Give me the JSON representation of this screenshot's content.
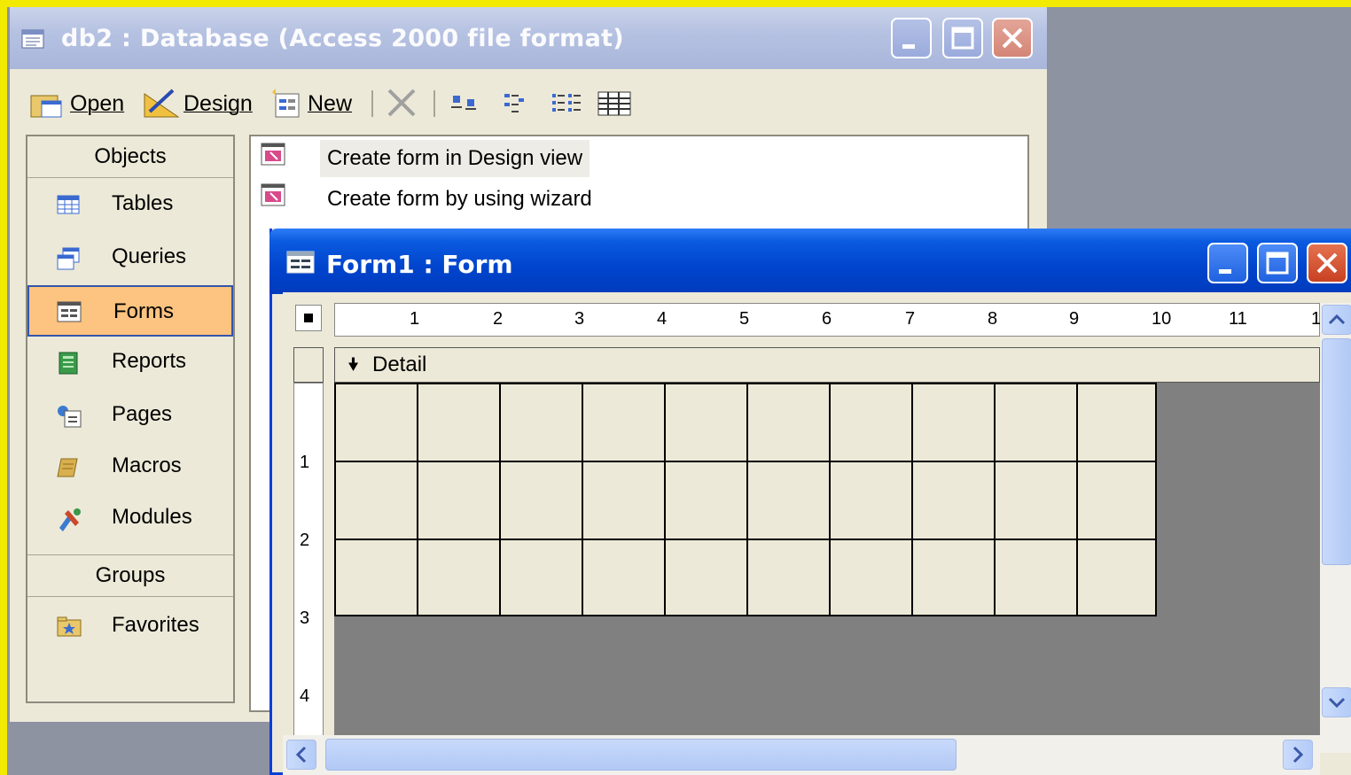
{
  "db_window": {
    "title": "db2 : Database (Access 2000 file format)",
    "toolbar": {
      "open": "Open",
      "design": "Design",
      "new": "New"
    },
    "objects_header": "Objects",
    "objects": [
      "Tables",
      "Queries",
      "Forms",
      "Reports",
      "Pages",
      "Macros",
      "Modules"
    ],
    "selected_object": "Forms",
    "groups_header": "Groups",
    "groups": [
      "Favorites"
    ],
    "list_items": [
      "Create form in Design view",
      "Create form by using wizard"
    ]
  },
  "form_window": {
    "title": "Form1 : Form",
    "ruler_top_labels": [
      "1",
      "2",
      "3",
      "4",
      "5",
      "6",
      "7",
      "8",
      "9",
      "10",
      "11",
      "1"
    ],
    "ruler_left_labels": [
      "1",
      "2",
      "3",
      "4"
    ],
    "section_label": "Detail"
  },
  "colors": {
    "frame_yellow": "#f2ea00",
    "form_title_blue": "#0044cc",
    "selected_object_bg": "#fdc380",
    "design_grid_bg": "#ece9d8",
    "canvas_gray": "#808080"
  }
}
